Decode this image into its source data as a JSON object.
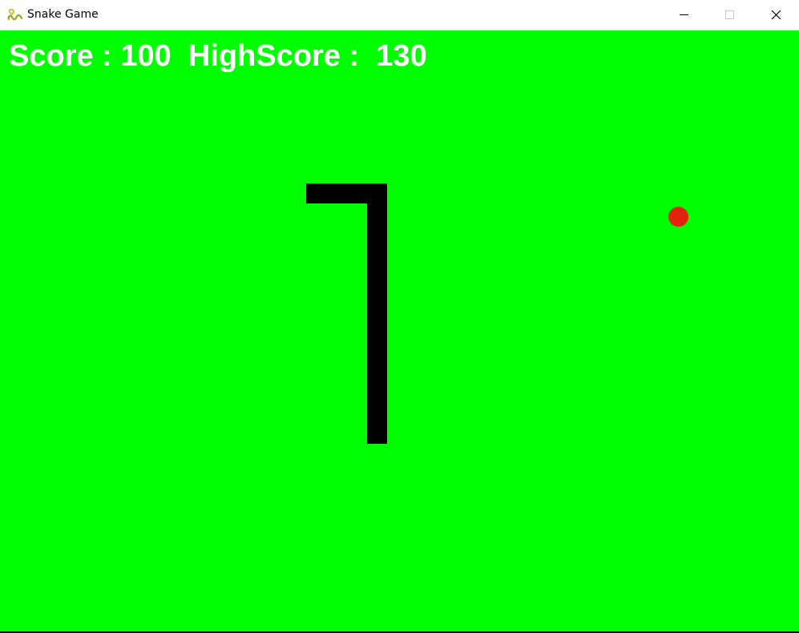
{
  "window": {
    "title": "Snake Game",
    "icon": "snake-app-icon",
    "controls": {
      "minimize_icon": "minimize-icon",
      "maximize_icon": "maximize-icon",
      "close_icon": "close-icon"
    }
  },
  "hud": {
    "score_label": "Score : ",
    "score_value": "100",
    "highscore_label": "HighScore : ",
    "highscore_value": "130"
  },
  "colors": {
    "background": "#00ff00",
    "snake": "#000000",
    "food": "#e2230f",
    "hud_text": "#ffffff"
  }
}
